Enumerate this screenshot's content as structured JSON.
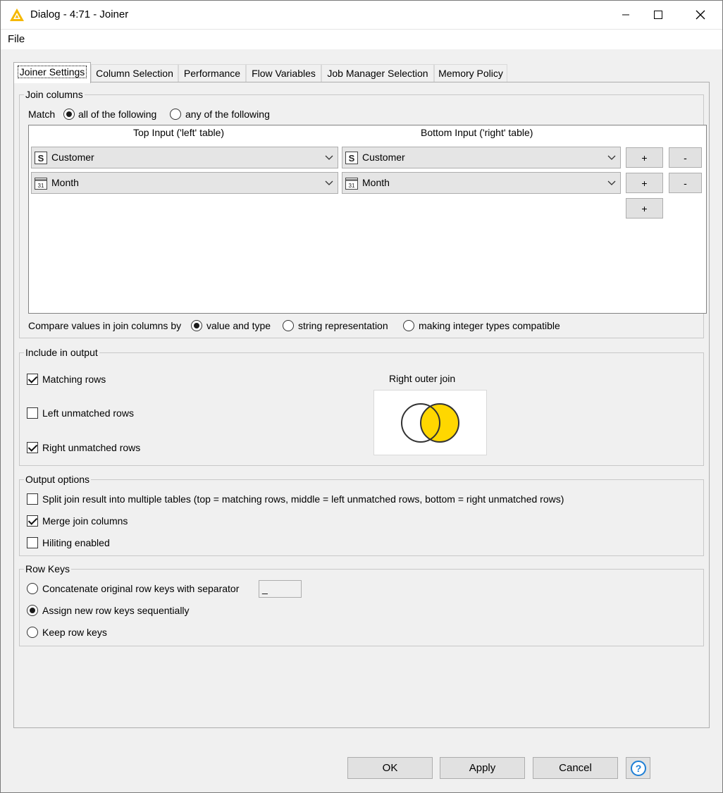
{
  "window": {
    "title": "Dialog - 4:71 - Joiner"
  },
  "menu": {
    "file": "File"
  },
  "tabs": [
    "Joiner Settings",
    "Column Selection",
    "Performance",
    "Flow Variables",
    "Job Manager Selection",
    "Memory Policy"
  ],
  "join_columns": {
    "label": "Join columns",
    "match_label": "Match",
    "match_all": "all of the following",
    "match_any": "any of the following",
    "match_selected": "all",
    "top_header": "Top Input ('left' table)",
    "bottom_header": "Bottom Input ('right' table)",
    "rows": [
      {
        "left": "Customer",
        "left_type": "S",
        "right": "Customer",
        "right_type": "S"
      },
      {
        "left": "Month",
        "left_type": "31",
        "right": "Month",
        "right_type": "31"
      }
    ],
    "plus": "+",
    "minus": "-",
    "compare_label": "Compare values in join columns by",
    "compare_value_type": "value and type",
    "compare_string": "string representation",
    "compare_integer": "making integer types compatible",
    "compare_selected": "value and type"
  },
  "include_output": {
    "label": "Include in output",
    "matching_rows": "Matching rows",
    "left_unmatched": "Left unmatched rows",
    "right_unmatched": "Right unmatched rows",
    "matching_checked": true,
    "left_checked": false,
    "right_checked": true,
    "join_type_label": "Right outer join",
    "venn_fill_color": "#ffd700"
  },
  "output_options": {
    "label": "Output options",
    "split": "Split join result into multiple tables (top = matching rows, middle = left unmatched rows, bottom = right unmatched rows)",
    "merge": "Merge join columns",
    "hiliting": "Hiliting enabled",
    "split_checked": false,
    "merge_checked": true,
    "hiliting_checked": false
  },
  "row_keys": {
    "label": "Row Keys",
    "concatenate": "Concatenate original row keys with separator",
    "separator_value": "_",
    "assign_new": "Assign new row keys sequentially",
    "keep": "Keep row keys",
    "selected": "assign_new"
  },
  "buttons": {
    "ok": "OK",
    "apply": "Apply",
    "cancel": "Cancel",
    "help": "?"
  }
}
